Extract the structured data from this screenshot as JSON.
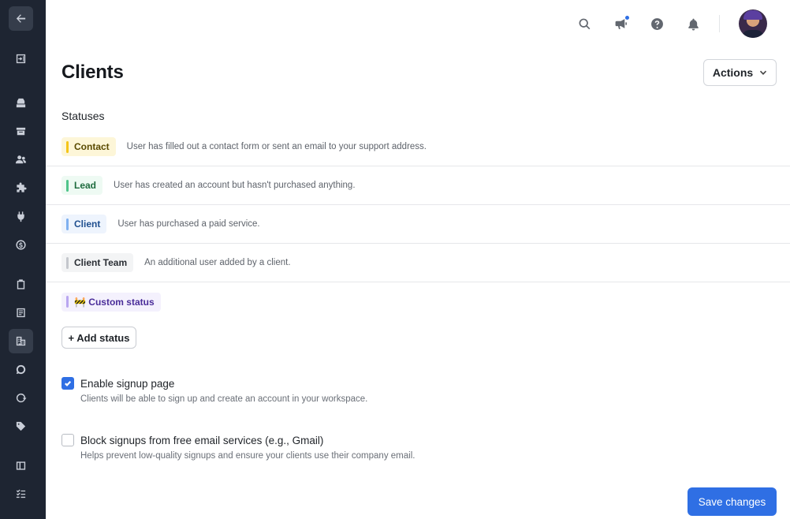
{
  "header": {
    "title": "Clients",
    "actions_label": "Actions"
  },
  "statuses": {
    "section_label": "Statuses",
    "items": [
      {
        "label": "Contact",
        "description": "User has filled out a contact form or sent an email to your support address.",
        "bar_color": "#f5c518",
        "bg_color": "#fdf6d8",
        "text_color": "#5a4a00"
      },
      {
        "label": "Lead",
        "description": "User has created an account but hasn't purchased anything.",
        "bar_color": "#4fc48a",
        "bg_color": "#eefaf3",
        "text_color": "#1e6b3e"
      },
      {
        "label": "Client",
        "description": "User has purchased a paid service.",
        "bar_color": "#7fb0f0",
        "bg_color": "#eef4fd",
        "text_color": "#1f4f8f"
      },
      {
        "label": "Client Team",
        "description": "An additional user added by a client.",
        "bar_color": "#c4c7cc",
        "bg_color": "#f3f4f5",
        "text_color": "#2a2e34"
      },
      {
        "label": "🚧 Custom status",
        "description": "",
        "bar_color": "#b9a6f0",
        "bg_color": "#f4f1fd",
        "text_color": "#4a2d99"
      }
    ],
    "add_label": "+ Add status"
  },
  "options": {
    "signup": {
      "label": "Enable signup page",
      "help": "Clients will be able to sign up and create an account in your workspace.",
      "checked": true
    },
    "block_free": {
      "label": "Block signups from free email services (e.g., Gmail)",
      "help": "Helps prevent low-quality signups and ensure your clients use their company email.",
      "checked": false
    }
  },
  "save_label": "Save changes",
  "colors": {
    "accent": "#2f6fe4",
    "sidebar_bg": "#1e2532"
  },
  "icons": {
    "sidebar": [
      "arrow-left-icon",
      "collapse-icon",
      "inbox-icon",
      "archive-icon",
      "users-icon",
      "puzzle-icon",
      "plug-icon",
      "billing-icon",
      "clipboard-icon",
      "document-icon",
      "building-icon",
      "chat-icon",
      "refresh-chat-icon",
      "tag-icon",
      "layout-icon",
      "checklist-icon"
    ],
    "header": [
      "search-icon",
      "megaphone-icon",
      "help-icon",
      "bell-icon"
    ]
  }
}
